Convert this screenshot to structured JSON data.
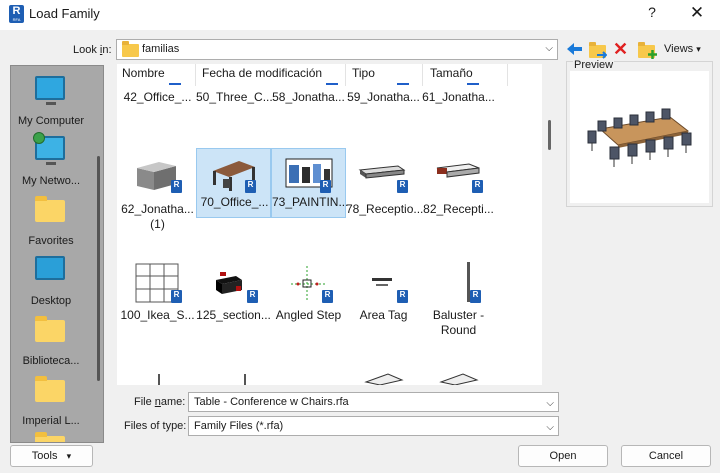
{
  "window": {
    "title": "Load Family",
    "help": "?",
    "close": "✕",
    "app_icon_letter": "R",
    "app_icon_sub": "RFA"
  },
  "lookin": {
    "label_prefix": "Look ",
    "label_accel": "i",
    "label_suffix": "n:",
    "value": "familias"
  },
  "toolbar": {
    "views_label": "Views"
  },
  "places": [
    {
      "label": "My Computer",
      "icon": "computer-icon"
    },
    {
      "label": "My Netwo...",
      "icon": "network-icon"
    },
    {
      "label": "Favorites",
      "icon": "folder-icon"
    },
    {
      "label": "Desktop",
      "icon": "desktop-icon"
    },
    {
      "label": "Biblioteca...",
      "icon": "folder-icon"
    },
    {
      "label": "Imperial L...",
      "icon": "folder-icon"
    }
  ],
  "columns": [
    "Nombre",
    "Fecha de modificación",
    "Tipo",
    "Tamaño"
  ],
  "files": [
    {
      "name": "42_Office_..."
    },
    {
      "name": "50_Three_C..."
    },
    {
      "name": "58_Jonatha..."
    },
    {
      "name": "59_Jonatha..."
    },
    {
      "name": "61_Jonatha..."
    },
    {
      "name": "62_Jonatha... (1)"
    },
    {
      "name": "70_Office_..."
    },
    {
      "name": "73_PAINTIN..."
    },
    {
      "name": "78_Receptio..."
    },
    {
      "name": "82_Recepti..."
    },
    {
      "name": "100_Ikea_S..."
    },
    {
      "name": "125_section..."
    },
    {
      "name": "Angled Step"
    },
    {
      "name": "Area Tag"
    },
    {
      "name": "Baluster - Round"
    }
  ],
  "preview": {
    "label": "Preview"
  },
  "filename": {
    "label_accel": "n",
    "label": "File name:",
    "value": "Table - Conference w Chairs.rfa"
  },
  "filetype": {
    "label": "Files of type:",
    "value": "Family Files (*.rfa)"
  },
  "buttons": {
    "tools": "Tools",
    "open": "Open",
    "cancel": "Cancel"
  },
  "colors": {
    "selection": "#cce4f7",
    "accent": "#1e5eb3",
    "places_bg": "#a8a8a8"
  }
}
